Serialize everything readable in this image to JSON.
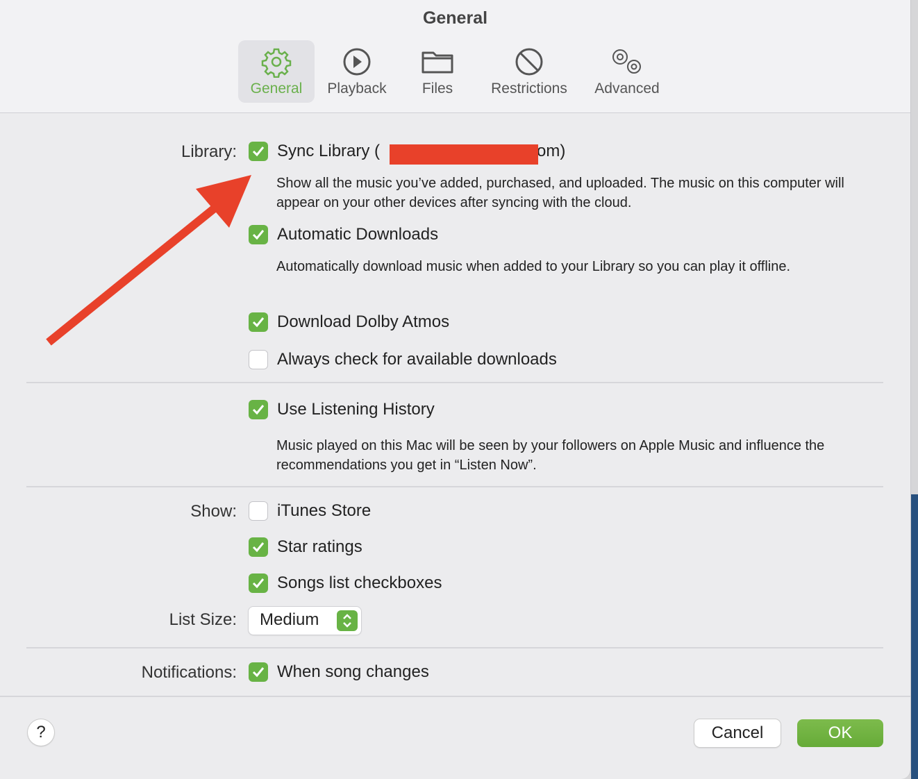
{
  "window": {
    "title": "General"
  },
  "tabs": [
    {
      "label": "General",
      "icon": "gear-icon",
      "selected": true
    },
    {
      "label": "Playback",
      "icon": "play-circle-icon",
      "selected": false
    },
    {
      "label": "Files",
      "icon": "folder-icon",
      "selected": false
    },
    {
      "label": "Restrictions",
      "icon": "prohibited-icon",
      "selected": false
    },
    {
      "label": "Advanced",
      "icon": "gears-icon",
      "selected": false
    }
  ],
  "library": {
    "label": "Library:",
    "sync_prefix": "Sync Library (",
    "sync_suffix": "com)",
    "sync_checked": true,
    "sync_desc": "Show all the music you’ve added, purchased, and uploaded. The music on this computer will appear on your other devices after syncing with the cloud.",
    "auto_label": "Automatic Downloads",
    "auto_checked": true,
    "auto_desc": "Automatically download music when added to your Library so you can play it offline.",
    "dolby_label": "Download Dolby Atmos",
    "dolby_checked": true,
    "always_label": "Always check for available downloads",
    "always_checked": false
  },
  "history": {
    "label": "Use Listening History",
    "checked": true,
    "desc": "Music played on this Mac will be seen by your followers on Apple Music and influence the recommendations you get in “Listen Now”."
  },
  "show": {
    "label": "Show:",
    "itunes": "iTunes Store",
    "itunes_checked": false,
    "stars": "Star ratings",
    "stars_checked": true,
    "songs": "Songs list checkboxes",
    "songs_checked": true
  },
  "list_size": {
    "label": "List Size:",
    "value": "Medium"
  },
  "notifications": {
    "label": "Notifications:",
    "option": "When song changes",
    "checked": true
  },
  "footer": {
    "help": "?",
    "cancel": "Cancel",
    "ok": "OK"
  },
  "colors": {
    "accent": "#68b345",
    "annotation": "#e8412a"
  }
}
